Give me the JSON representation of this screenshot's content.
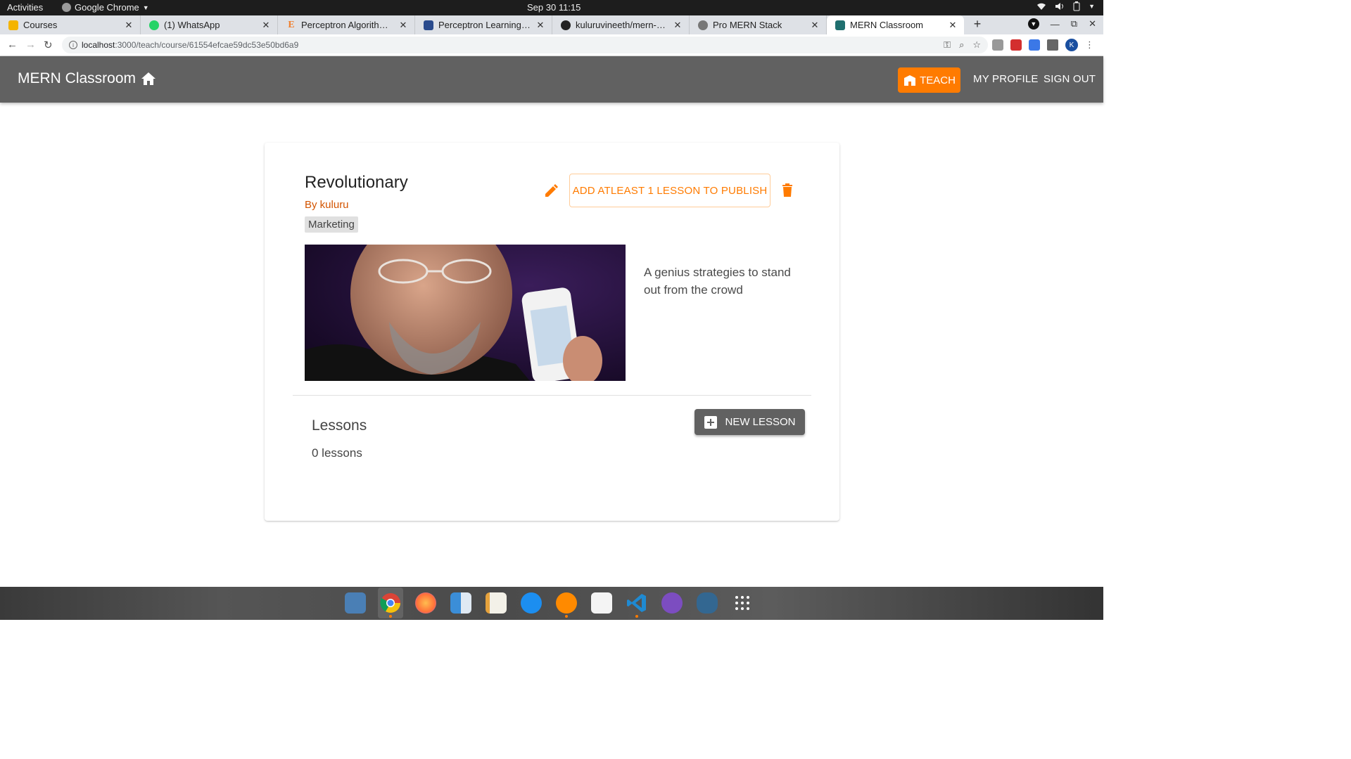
{
  "system_bar": {
    "activities": "Activities",
    "app_menu": "Google Chrome",
    "clock": "Sep 30  11:15"
  },
  "browser": {
    "tabs": [
      {
        "title": "Courses",
        "favicon_color": "#f4b400"
      },
      {
        "title": "(1) WhatsApp",
        "favicon_color": "#25d366"
      },
      {
        "title": "Perceptron Algorithm - an",
        "favicon_color": "#f08030"
      },
      {
        "title": "Perceptron Learning Algo",
        "favicon_color": "#2a4b8d"
      },
      {
        "title": "kuluruvineeth/mern-class",
        "favicon_color": "#222222"
      },
      {
        "title": "Pro MERN Stack",
        "favicon_color": "#777777"
      },
      {
        "title": "MERN Classroom",
        "favicon_color": "#1f6f6f"
      }
    ],
    "active_tab": 6,
    "url_host": "localhost",
    "url_path": ":3000/teach/course/61554efcae59dc53e50bd6a9",
    "profile_initial": "K"
  },
  "appbar": {
    "brand": "MERN Classroom",
    "teach_label": "TEACH",
    "my_profile_label": "MY PROFILE",
    "sign_out_label": "SIGN OUT",
    "accent_color": "#ff7b00",
    "bar_color": "#616161"
  },
  "course": {
    "title": "Revolutionary",
    "author": "By kuluru",
    "category": "Marketing",
    "publish_label": "ADD ATLEAST 1 LESSON TO PUBLISH",
    "description": "A genius strategies to stand out from the crowd"
  },
  "lessons": {
    "title": "Lessons",
    "count_text": "0 lessons",
    "new_lesson_label": "NEW LESSON"
  },
  "dock": {
    "items": [
      {
        "name": "screenshot",
        "color": "#4a7fb5"
      },
      {
        "name": "chrome",
        "color": "#db4437",
        "running": true
      },
      {
        "name": "firefox",
        "color": "#ff7139"
      },
      {
        "name": "finder",
        "color": "#3b8ed8"
      },
      {
        "name": "text-editor",
        "color": "#e8e8e8"
      },
      {
        "name": "app-store",
        "color": "#1c8ef0"
      },
      {
        "name": "books",
        "color": "#ff8a00"
      },
      {
        "name": "notes",
        "color": "#f4f4f4"
      },
      {
        "name": "vscode",
        "color": "#1f8ad2"
      },
      {
        "name": "github",
        "color": "#7c4dc0"
      },
      {
        "name": "postgresql",
        "color": "#336791"
      },
      {
        "name": "app-grid",
        "color": "#ffffff"
      }
    ]
  }
}
